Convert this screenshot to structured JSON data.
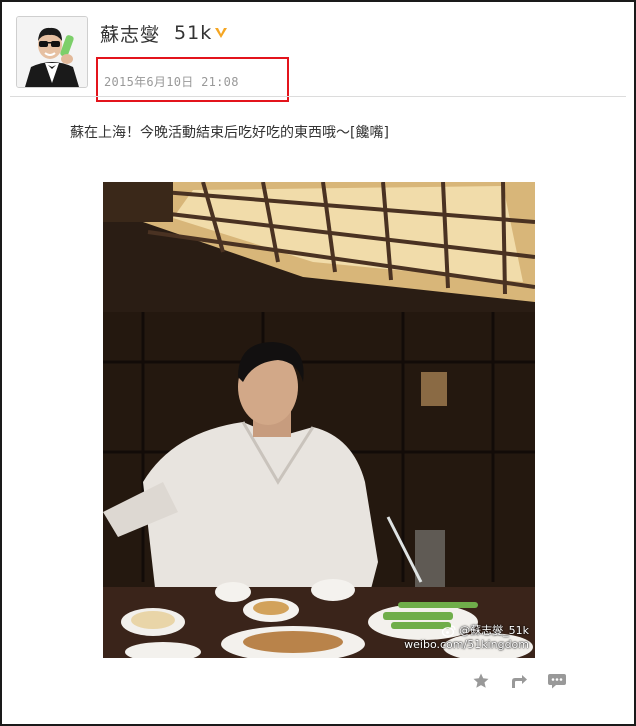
{
  "user": {
    "name": "蘇志燮",
    "handle_suffix": "51k",
    "verified_icon": "verified-v-icon"
  },
  "post": {
    "timestamp": "2015年6月10日 21:08",
    "text": "蘇在上海！今晚活動結束后吃好吃的東西哦～[饞嘴]"
  },
  "photo": {
    "watermark_handle": "@蘇志燮_51k",
    "watermark_url": "weibo.com/51kingdom"
  },
  "actions": [
    {
      "name": "favorite",
      "icon": "star-icon"
    },
    {
      "name": "repost",
      "icon": "repost-icon"
    },
    {
      "name": "comment",
      "icon": "comment-icon"
    }
  ],
  "colors": {
    "highlight_border": "#e3141c",
    "verified_badge": "#f5a623",
    "icon_gray": "#999999"
  }
}
